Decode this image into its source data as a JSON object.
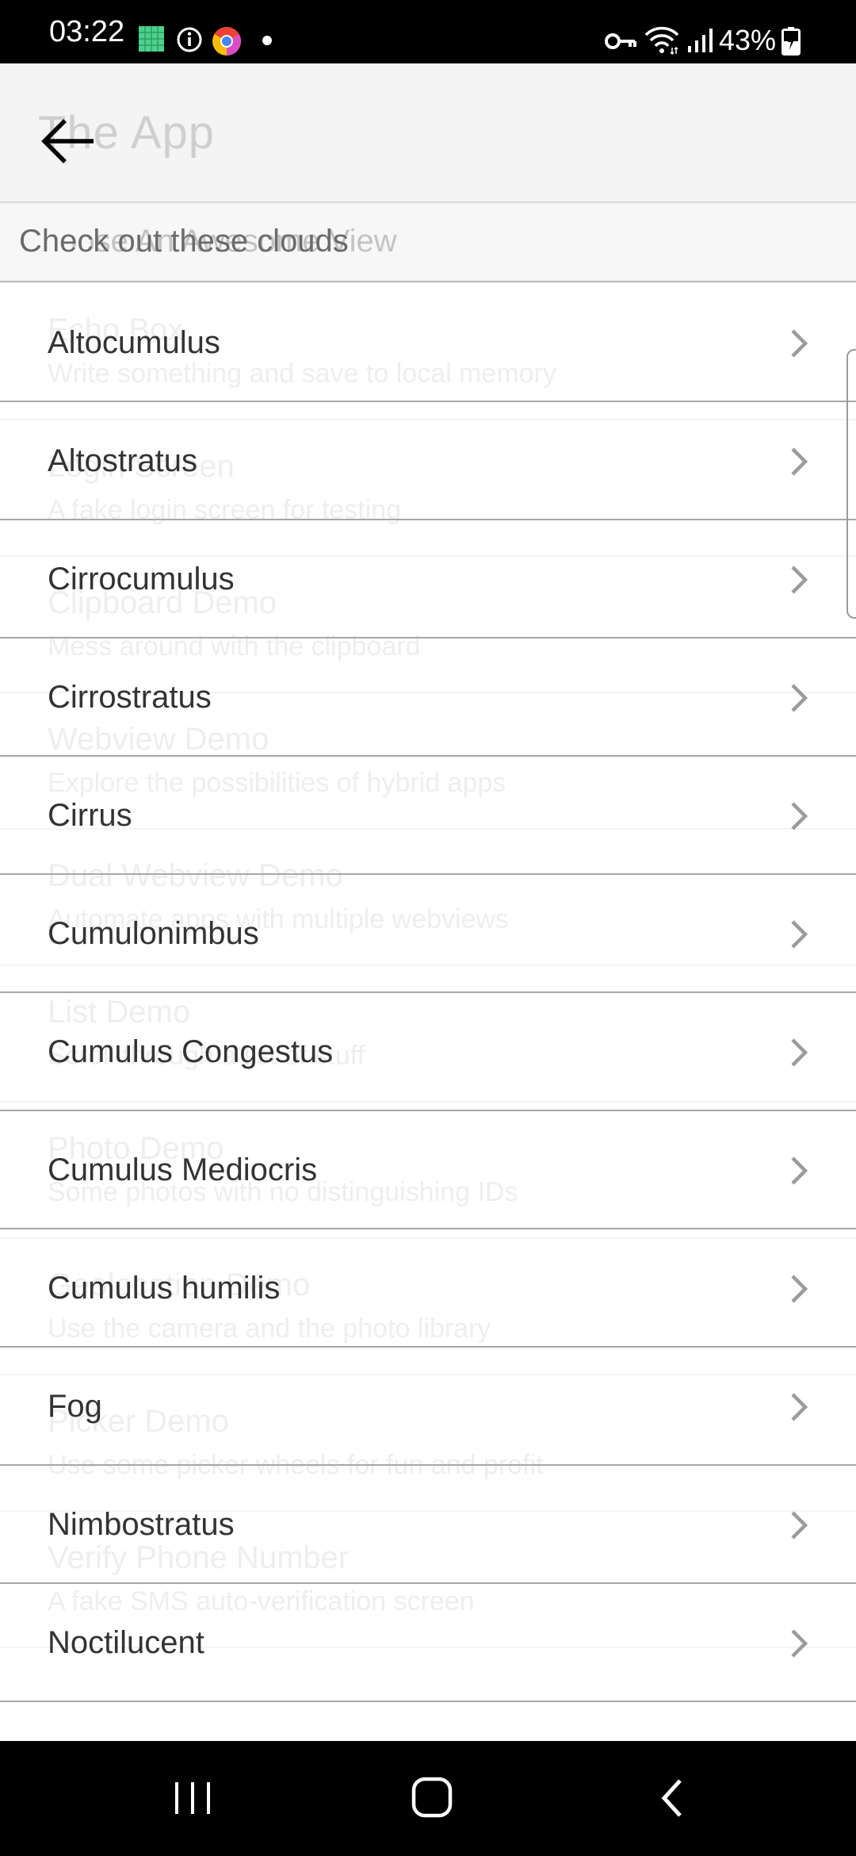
{
  "status_bar": {
    "time": "03:22",
    "battery_percent": "43%",
    "icons": [
      "app-square-icon",
      "info-icon",
      "chrome-icon",
      "notification-dot-icon",
      "vpn-key-icon",
      "wifi-icon",
      "signal-icon",
      "battery-charging-icon"
    ]
  },
  "toolbar": {
    "back_icon": "arrow-left-icon",
    "ghost_title": "The App"
  },
  "section": {
    "title": "Check out these clouds",
    "ghost_title": "Choose An Awesome View"
  },
  "clouds": [
    {
      "label": "Altocumulus"
    },
    {
      "label": "Altostratus"
    },
    {
      "label": "Cirrocumulus"
    },
    {
      "label": "Cirrostratus"
    },
    {
      "label": "Cirrus"
    },
    {
      "label": "Cumulonimbus"
    },
    {
      "label": "Cumulus Congestus"
    },
    {
      "label": "Cumulus Mediocris"
    },
    {
      "label": "Cumulus humilis"
    },
    {
      "label": "Fog"
    },
    {
      "label": "Nimbostratus"
    },
    {
      "label": "Noctilucent"
    }
  ],
  "ghost_views": [
    {
      "title": "Echo Box",
      "subtitle": "Write something and save to local memory"
    },
    {
      "title": "Login Screen",
      "subtitle": "A fake login screen for testing"
    },
    {
      "title": "Clipboard Demo",
      "subtitle": "Mess around with the clipboard"
    },
    {
      "title": "Webview Demo",
      "subtitle": "Explore the possibilities of hybrid apps"
    },
    {
      "title": "Dual Webview Demo",
      "subtitle": "Automate apps with multiple webviews"
    },
    {
      "title": "List Demo",
      "subtitle": "Scroll through a list of stuff"
    },
    {
      "title": "Photo Demo",
      "subtitle": "Some photos with no distinguishing IDs"
    },
    {
      "title": "Geolocation Demo",
      "subtitle": "Use the camera and the photo library"
    },
    {
      "title": "Picker Demo",
      "subtitle": "Use some picker wheels for fun and profit"
    },
    {
      "title": "Verify Phone Number",
      "subtitle": "A fake SMS auto-verification screen"
    }
  ],
  "nav_bar": {
    "recents_icon": "recents-icon",
    "home_icon": "home-icon",
    "back_icon": "nav-back-icon"
  }
}
